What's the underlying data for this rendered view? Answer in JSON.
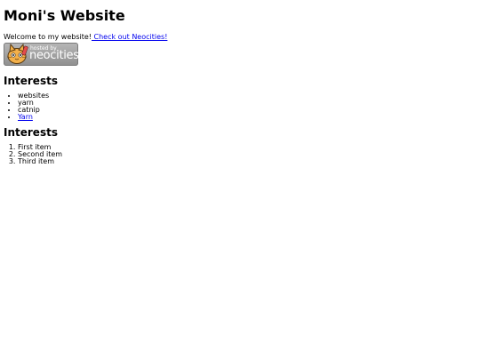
{
  "page": {
    "title": "Moni's Website",
    "welcome_text": "Welcome to my website!",
    "welcome_link": " Check out Neocities!"
  },
  "badge": {
    "hosted_by": "hosted by",
    "brand": "neocities",
    "icon": "neocities-cat-icon"
  },
  "interests_unordered": {
    "heading": "Interests",
    "items": [
      "websites",
      "yarn",
      "catnip"
    ],
    "link_item": "Yarn"
  },
  "interests_ordered": {
    "heading": "Interests",
    "items": [
      "First item",
      "Second item",
      "Third item"
    ]
  },
  "colors": {
    "link": "#0000ee",
    "badge_gray": "#9a9a9a",
    "cat_orange": "#f0a030"
  }
}
